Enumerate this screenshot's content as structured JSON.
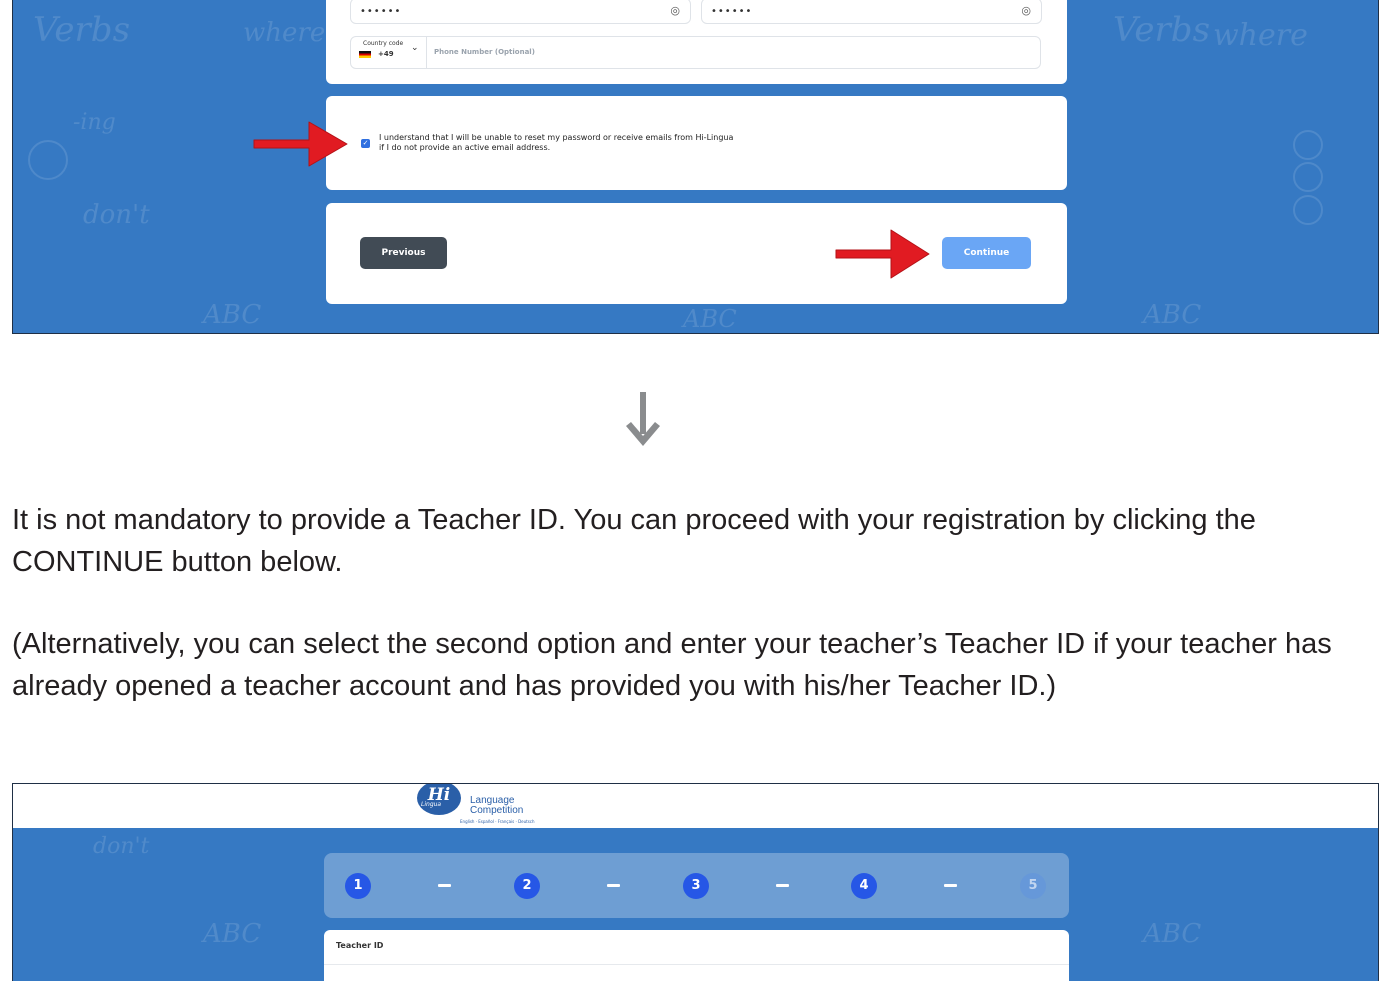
{
  "top_screenshot": {
    "password_mask": "••••••",
    "confirm_password_mask": "••••••",
    "country_code_label": "Country code",
    "country_code_value": "+49",
    "phone_placeholder": "Phone Number (Optional)",
    "consent_line1": "I understand that I will be unable to reset my password or receive emails from Hi-Lingua",
    "consent_line2": "if I do not provide an active email address.",
    "previous_label": "Previous",
    "continue_label": "Continue",
    "colors": {
      "background": "#3679c3",
      "continue_button": "#6aa6f5",
      "previous_button": "#414b55",
      "arrow": "#e11b22"
    }
  },
  "instructions": {
    "paragraph1": "It is not mandatory to provide a Teacher ID. You can proceed with your registration by clicking the CONTINUE button below.",
    "paragraph2": "(Alternatively, you can select the second option and enter your teacher’s Teacher ID if your teacher has already opened a teacher account and has provided you with his/her Teacher ID.)"
  },
  "bottom_screenshot": {
    "logo_mark": "Hi",
    "logo_sub": "Lingua",
    "logo_line1": "Language",
    "logo_line2": "Competition",
    "logo_tagline": "English · Español · Français · Deutsch",
    "steps": [
      "1",
      "2",
      "3",
      "4",
      "5"
    ],
    "teacher_id_title": "Teacher ID",
    "colors": {
      "step_active": "#2657e6"
    }
  }
}
